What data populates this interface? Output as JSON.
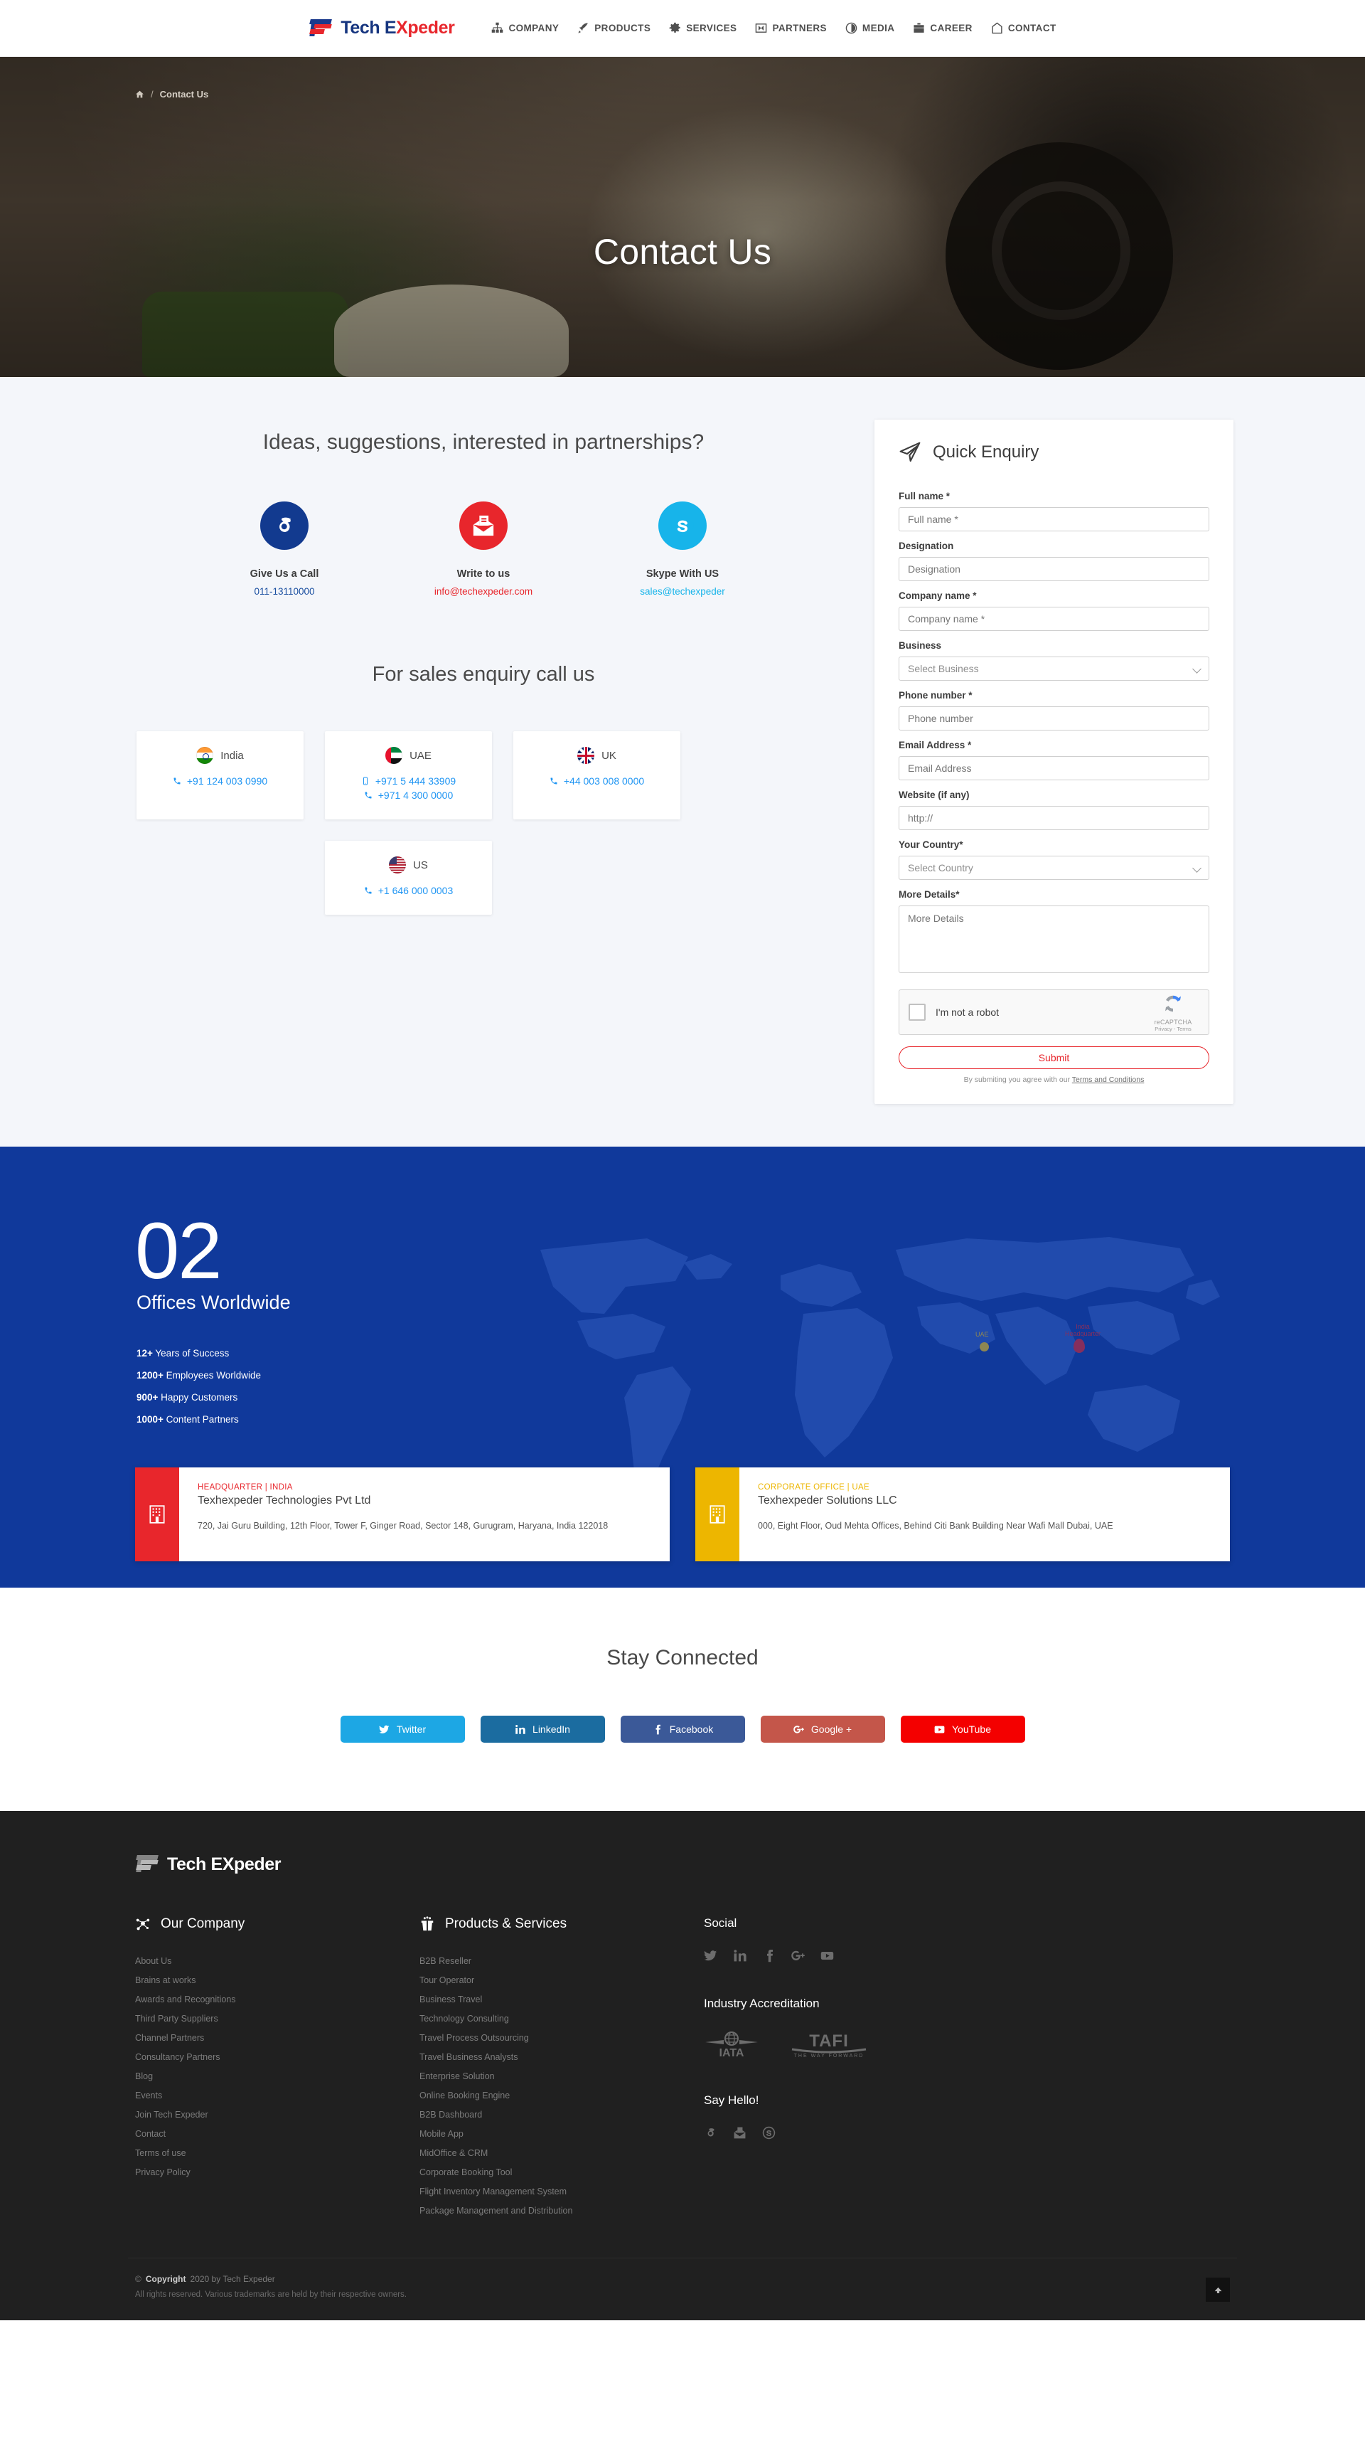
{
  "brand": {
    "part1": "Tech E",
    "part2": "Xpeder",
    "full": "Tech EXpeder"
  },
  "nav": [
    {
      "label": "COMPANY",
      "icon": "sitemap-icon"
    },
    {
      "label": "PRODUCTS",
      "icon": "rocket-icon"
    },
    {
      "label": "SERVICES",
      "icon": "gear-icon"
    },
    {
      "label": "PARTNERS",
      "icon": "handshake-icon"
    },
    {
      "label": "MEDIA",
      "icon": "circle-icon"
    },
    {
      "label": "CAREER",
      "icon": "briefcase-icon"
    },
    {
      "label": "CONTACT",
      "icon": "tag-icon"
    }
  ],
  "hero": {
    "title": "Contact Us",
    "breadcrumb_home": "home-icon",
    "breadcrumb_sep": "/",
    "breadcrumb_current": "Contact Us"
  },
  "contact": {
    "heading": "Ideas, suggestions, interested in partnerships?",
    "methods": [
      {
        "title": "Give Us a Call",
        "value": "011-13110000",
        "icon": "phone-icon",
        "bg": "#123a8f",
        "value_color": "#1a4fa0"
      },
      {
        "title": "Write to us",
        "value": "info@techexpeder.com",
        "icon": "envelope-open-icon",
        "bg": "#e8262c",
        "value_color": "#e8262c"
      },
      {
        "title": "Skype With US",
        "value": "sales@techexpeder",
        "icon": "skype-icon",
        "bg": "#17b4ea",
        "value_color": "#17b4ea"
      }
    ],
    "sales_heading": "For sales enquiry call us",
    "countries": [
      {
        "name": "India",
        "flag": "flag-india",
        "numbers": [
          {
            "icon": "phone-icon",
            "value": "+91 124 003 0990"
          }
        ]
      },
      {
        "name": "UAE",
        "flag": "flag-uae",
        "numbers": [
          {
            "icon": "mobile-icon",
            "value": "+971 5 444 33909"
          },
          {
            "icon": "phone-icon",
            "value": "+971 4 300 0000"
          }
        ]
      },
      {
        "name": "UK",
        "flag": "flag-uk",
        "numbers": [
          {
            "icon": "phone-icon",
            "value": "+44 003 008 0000"
          }
        ]
      },
      {
        "name": "US",
        "flag": "flag-us",
        "numbers": [
          {
            "icon": "phone-icon",
            "value": "+1 646 000 0003"
          }
        ]
      }
    ]
  },
  "enquiry": {
    "title": "Quick Enquiry",
    "icon": "paper-plane-icon",
    "fields": [
      {
        "label": "Full name *",
        "placeholder": "Full name *",
        "type": "text"
      },
      {
        "label": "Designation",
        "placeholder": "Designation",
        "type": "text"
      },
      {
        "label": "Company name *",
        "placeholder": "Company name *",
        "type": "text"
      },
      {
        "label": "Business",
        "placeholder": "Select Business",
        "type": "select"
      },
      {
        "label": "Phone number *",
        "placeholder": "Phone number",
        "type": "text"
      },
      {
        "label": "Email Address *",
        "placeholder": "Email Address",
        "type": "text"
      },
      {
        "label": "Website (if any)",
        "placeholder": "http://",
        "type": "text"
      },
      {
        "label": "Your Country*",
        "placeholder": "Select Country",
        "type": "select"
      },
      {
        "label": "More Details*",
        "placeholder": "More Details",
        "type": "textarea"
      }
    ],
    "captcha_label": "I'm not a robot",
    "captcha_brand": "reCAPTCHA",
    "captcha_terms": "Privacy - Terms",
    "submit_label": "Submit",
    "terms_prefix": "By submiting you agree with our ",
    "terms_link": "Terms and Conditions"
  },
  "offices": {
    "count": "02",
    "subtitle": "Offices Worldwide",
    "stats": [
      {
        "value": "12+",
        "text": " Years of Success"
      },
      {
        "value": "1200+",
        "text": " Employees Worldwide"
      },
      {
        "value": "900+",
        "text": " Happy Customers"
      },
      {
        "value": "1000+",
        "text": " Content Partners"
      }
    ],
    "map_pins": [
      {
        "label": "UAE",
        "color": "#f5c518"
      },
      {
        "label": "India\nHeadquarter",
        "color": "#e8262c"
      }
    ],
    "addresses": [
      {
        "kicker": "HEADQUARTER | INDIA",
        "name": "Texhexpeder Technologies Pvt Ltd",
        "text": "720, Jai Guru Building, 12th Floor, Tower F, Ginger Road, Sector 148, Gurugram, Haryana, India 122018",
        "accent": "#e8262c",
        "icon": "building-icon"
      },
      {
        "kicker": "CORPORATE OFFICE | UAE",
        "name": "Texhexpeder Solutions LLC",
        "text": "000, Eight Floor, Oud Mehta Offices, Behind Citi Bank Building Near Wafi Mall Dubai, UAE",
        "accent": "#edb600",
        "icon": "building-icon"
      }
    ]
  },
  "stay": {
    "title": "Stay Connected",
    "buttons": [
      {
        "label": "Twitter",
        "icon": "twitter-icon",
        "color": "#1DA7E4"
      },
      {
        "label": "LinkedIn",
        "icon": "linkedin-icon",
        "color": "#1B6CA0"
      },
      {
        "label": "Facebook",
        "icon": "facebook-icon",
        "color": "#3B5998"
      },
      {
        "label": "Google +",
        "icon": "google-plus-icon",
        "color": "#C4564A"
      },
      {
        "label": "YouTube",
        "icon": "youtube-icon",
        "color": "#F40000"
      }
    ]
  },
  "footer": {
    "company": {
      "heading": "Our Company",
      "icon": "network-icon",
      "links": [
        "About Us",
        "Brains at works",
        "Awards and Recognitions",
        "Third Party Suppliers",
        "Channel Partners",
        "Consultancy Partners",
        "Blog",
        "Events",
        "Join Tech Expeder",
        "Contact",
        "Terms of use",
        "Privacy Policy"
      ]
    },
    "products": {
      "heading": "Products & Services",
      "icon": "gift-box-icon",
      "links": [
        "B2B Reseller",
        "Tour Operator",
        "Business Travel",
        "Technology Consulting",
        "Travel Process Outsourcing",
        "Travel Business Analysts",
        "Enterprise Solution",
        "Online Booking Engine",
        "B2B Dashboard",
        "Mobile App",
        "MidOffice & CRM",
        "Corporate Booking Tool",
        "Flight Inventory Management System",
        "Package Management and Distribution"
      ]
    },
    "social": {
      "heading": "Social",
      "icons": [
        "twitter-icon",
        "linkedin-icon",
        "facebook-icon",
        "google-plus-icon",
        "youtube-icon"
      ]
    },
    "accreditation": {
      "heading": "Industry Accreditation",
      "logos": [
        {
          "name": "IATA",
          "label": "IATA"
        },
        {
          "name": "TAFI",
          "label": "TAFI",
          "tagline": "THE WAY FORWARD"
        }
      ]
    },
    "sayhello": {
      "heading": "Say Hello!",
      "icons": [
        "phone-icon",
        "envelope-icon",
        "skype-icon"
      ]
    },
    "copyright_symbol": "©",
    "copyright_word": "Copyright",
    "copyright_rest": "2020 by Tech Expeder",
    "rights": "All rights reserved. Various trademarks are held by their respective owners.",
    "to_top_icon": "chevron-up-icon"
  }
}
